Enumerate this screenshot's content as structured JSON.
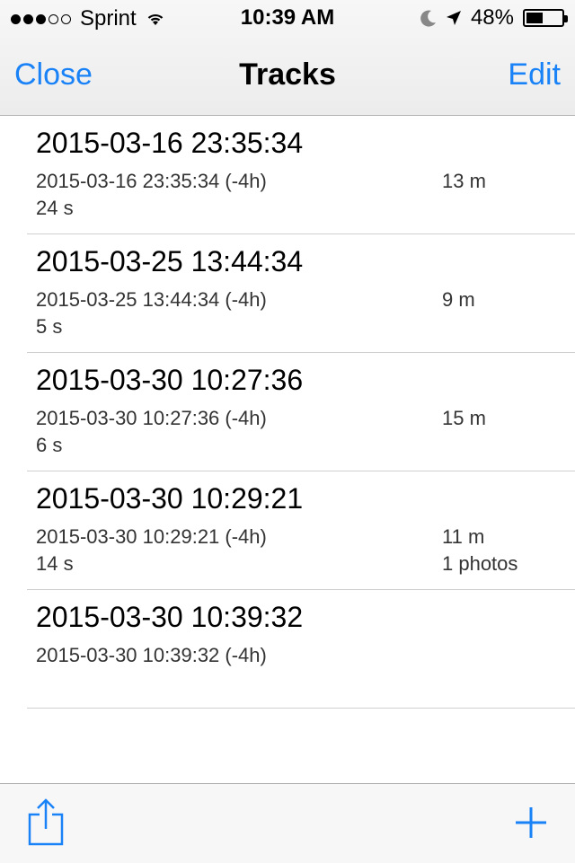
{
  "status_bar": {
    "carrier": "Sprint",
    "time": "10:39 AM",
    "battery": "48%",
    "battery_level": 0.48,
    "signal_bars_filled": 3,
    "signal_bars_total": 5
  },
  "nav": {
    "left_button": "Close",
    "title": "Tracks",
    "right_button": "Edit"
  },
  "tracks": [
    {
      "title": "2015-03-16 23:35:34",
      "subtitle": "2015-03-16 23:35:34 (-4h)",
      "duration": "24 s",
      "distance": "13 m",
      "photos": ""
    },
    {
      "title": "2015-03-25 13:44:34",
      "subtitle": "2015-03-25 13:44:34 (-4h)",
      "duration": "5 s",
      "distance": "9 m",
      "photos": ""
    },
    {
      "title": "2015-03-30 10:27:36",
      "subtitle": "2015-03-30 10:27:36 (-4h)",
      "duration": "6 s",
      "distance": "15 m",
      "photos": ""
    },
    {
      "title": "2015-03-30 10:29:21",
      "subtitle": "2015-03-30 10:29:21 (-4h)",
      "duration": "14 s",
      "distance": "11 m",
      "photos": "1 photos"
    },
    {
      "title": "2015-03-30 10:39:32",
      "subtitle": "2015-03-30 10:39:32 (-4h)",
      "duration": "",
      "distance": "",
      "photos": ""
    }
  ],
  "colors": {
    "accent": "#1a82f7"
  },
  "toolbar": {
    "left_icon": "share-icon",
    "right_icon": "plus-icon"
  }
}
